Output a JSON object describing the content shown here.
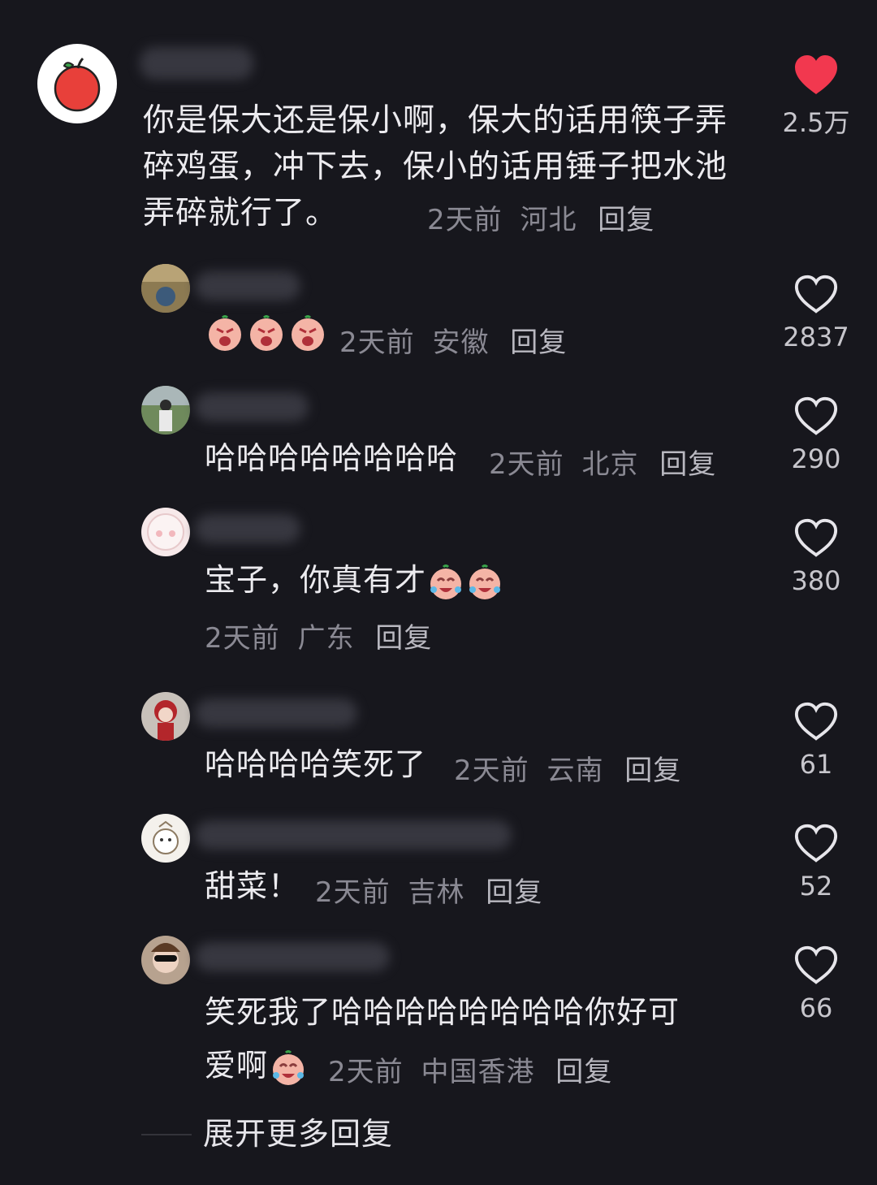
{
  "main_comment": {
    "text": "你是保大还是保小啊，保大的话用筷子弄碎鸡蛋，冲下去，保小的话用锤子把水池弄碎就行了。",
    "time": "2天前",
    "location": "河北",
    "reply": "回复",
    "likes": "2.5万",
    "liked": true
  },
  "replies": [
    {
      "text": "",
      "time": "2天前",
      "location": "安徽",
      "reply": "回复",
      "likes": "2837",
      "emoji": [
        "crying-emoji",
        "crying-emoji",
        "crying-emoji"
      ]
    },
    {
      "text": "哈哈哈哈哈哈哈哈",
      "time": "2天前",
      "location": "北京",
      "reply": "回复",
      "likes": "290"
    },
    {
      "text": "宝子，你真有才",
      "time": "2天前",
      "location": "广东",
      "reply": "回复",
      "likes": "380",
      "emoji": [
        "laughing-crying-emoji",
        "laughing-crying-emoji"
      ]
    },
    {
      "text": "哈哈哈哈笑死了",
      "time": "2天前",
      "location": "云南",
      "reply": "回复",
      "likes": "61"
    },
    {
      "text": "甜菜！",
      "time": "2天前",
      "location": "吉林",
      "reply": "回复",
      "likes": "52"
    },
    {
      "text": "笑死我了哈哈哈哈哈哈哈哈你好可",
      "text2": "爱啊",
      "time": "2天前",
      "location": "中国香港",
      "reply": "回复",
      "likes": "66",
      "emoji": [
        "laughing-crying-emoji"
      ]
    }
  ],
  "expand_label": "展开更多回复",
  "colors": {
    "background": "#17171d",
    "like_red": "#f2384f",
    "meta": "#8a8993"
  }
}
